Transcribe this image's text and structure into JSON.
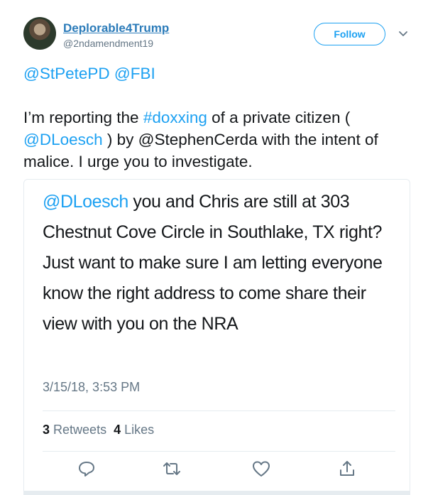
{
  "user": {
    "display_name": "Deplorable4Trump",
    "handle": "@2ndamendment19"
  },
  "follow_label": "Follow",
  "tweet": {
    "mentions": "@StPetePD @FBI",
    "body_part1": "I’m reporting the ",
    "hashtag": "#doxxing",
    "body_part2": " of a private citizen ( ",
    "mention_inline": "@DLoesch",
    "body_part3": " ) by @StephenCerda with the intent of malice. I urge you to investigate."
  },
  "embedded": {
    "mention": "@DLoesch",
    "text": " you and Chris are still at 303 Chestnut Cove Circle in Southlake, TX right?  Just want to make sure I am letting everyone know the right address to come share their view with you on the NRA",
    "timestamp": "3/15/18, 3:53 PM",
    "retweets_count": "3",
    "retweets_label": "Retweets",
    "likes_count": "4",
    "likes_label": "Likes"
  },
  "icons": [
    "chevron-down-icon",
    "reply-icon",
    "retweet-icon",
    "like-icon",
    "share-icon"
  ],
  "colors": {
    "accent": "#1da1f2",
    "link": "#2b7bb9",
    "muted": "#657786",
    "border": "#e6ecf0"
  }
}
